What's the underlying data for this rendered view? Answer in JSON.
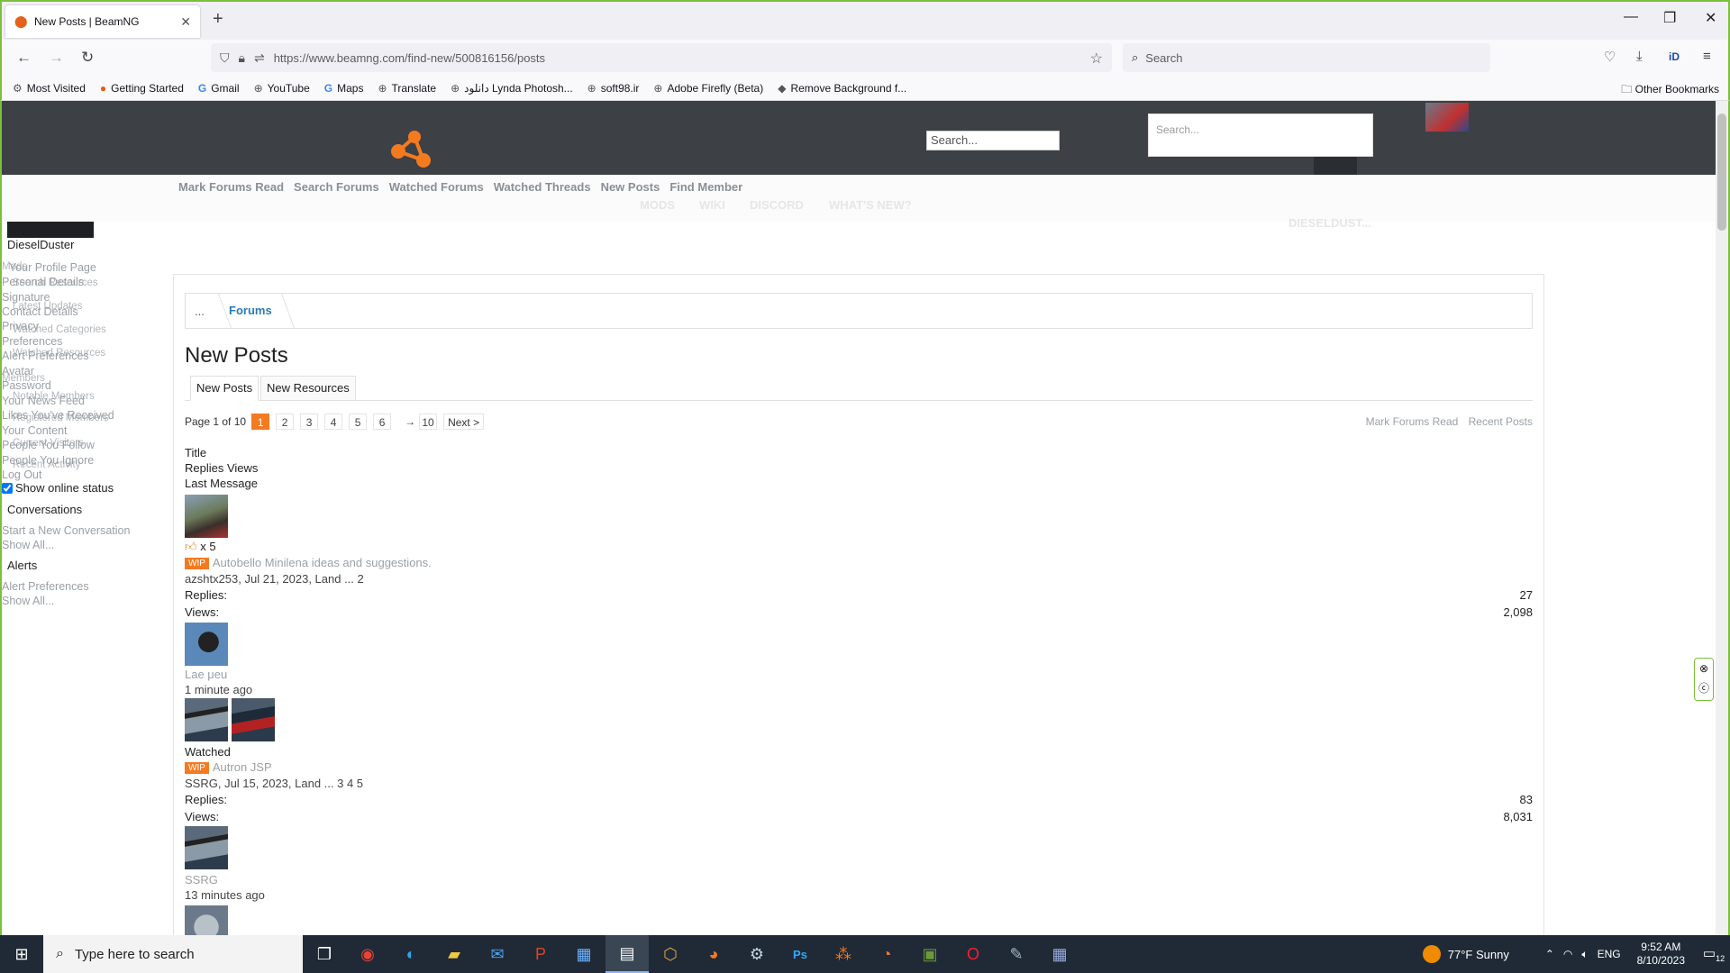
{
  "browser": {
    "tab_title": "New Posts | BeamNG",
    "url": "https://www.beamng.com/find-new/500816156/posts",
    "search_placeholder": "Search",
    "bookmarks": [
      "Most Visited",
      "Getting Started",
      "Gmail",
      "YouTube",
      "Maps",
      "Translate",
      "دانلود Lynda Photosh...",
      "soft98.ir",
      "Adobe Firefly (Beta)",
      "Remove Background f..."
    ],
    "other_bookmarks": "Other Bookmarks"
  },
  "header": {
    "search1_placeholder": "Search...",
    "search2_placeholder": "Search..."
  },
  "subnav": {
    "links": [
      "Mark Forums Read",
      "Search Forums",
      "Watched Forums",
      "Watched Threads",
      "New Posts",
      "Find Member"
    ],
    "ghost": [
      "MODS",
      "WIKI",
      "DISCORD",
      "WHAT'S NEW?",
      "DIESELDUST..."
    ]
  },
  "leftpanel": {
    "username": "DieselDuster",
    "account_items": [
      "Your Profile Page",
      "Personal Details",
      "Signature",
      "Contact Details",
      "Privacy",
      "Preferences",
      "Alert Preferences",
      "Avatar",
      "Password",
      "Your News Feed",
      "Likes You've Received",
      "Your Content",
      "People You Follow",
      "People You Ignore",
      "Log Out"
    ],
    "ghost_items": [
      "Mods",
      "Search Resources",
      "Latest Updates",
      "Watched Categories",
      "Watched Resources",
      "Members",
      "Notable Members",
      "Registered Members",
      "Current Visitors",
      "Recent Activity"
    ],
    "online_status": "Show online status",
    "conversations": "Conversations",
    "conv_items": [
      "Start a New Conversation",
      "Show All..."
    ],
    "alerts": "Alerts",
    "alert_items": [
      "Alert Preferences",
      "Show All..."
    ]
  },
  "breadcrumb": {
    "home": "...",
    "forums": "Forums"
  },
  "page": {
    "title": "New Posts",
    "tabs": [
      "New Posts",
      "New Resources"
    ],
    "pager_label": "Page 1 of 10",
    "pages": [
      "1",
      "2",
      "3",
      "4",
      "5",
      "6"
    ],
    "arrow": "→",
    "last": "10",
    "next": "Next >",
    "right_links": [
      "Mark Forums Read",
      "Recent Posts"
    ],
    "col_title": "Title",
    "col_replies_views": "Replies Views",
    "col_last": "Last Message"
  },
  "threads": [
    {
      "likes": "x 5",
      "prefix": "WIP",
      "title": "Autobello Minilena ideas and suggestions.",
      "meta": "azshtx253, Jul 21, 2023, Land ... 2",
      "replies_label": "Replies:",
      "replies": "27",
      "views_label": "Views:",
      "views": "2,098",
      "last_user": "Lae μeu",
      "last_time": "1 minute ago"
    },
    {
      "watched": "Watched",
      "prefix": "WIP",
      "title": "Autron JSP",
      "meta": "SSRG, Jul 15, 2023, Land ... 3 4 5",
      "replies_label": "Replies:",
      "replies": "83",
      "views_label": "Views:",
      "views": "8,031",
      "last_user": "SSRG",
      "last_time": "13 minutes ago"
    }
  ],
  "taskbar": {
    "search_placeholder": "Type here to search",
    "weather": "77°F  Sunny",
    "lang": "ENG",
    "time": "9:52 AM",
    "date": "8/10/2023",
    "notif_count": "12"
  }
}
